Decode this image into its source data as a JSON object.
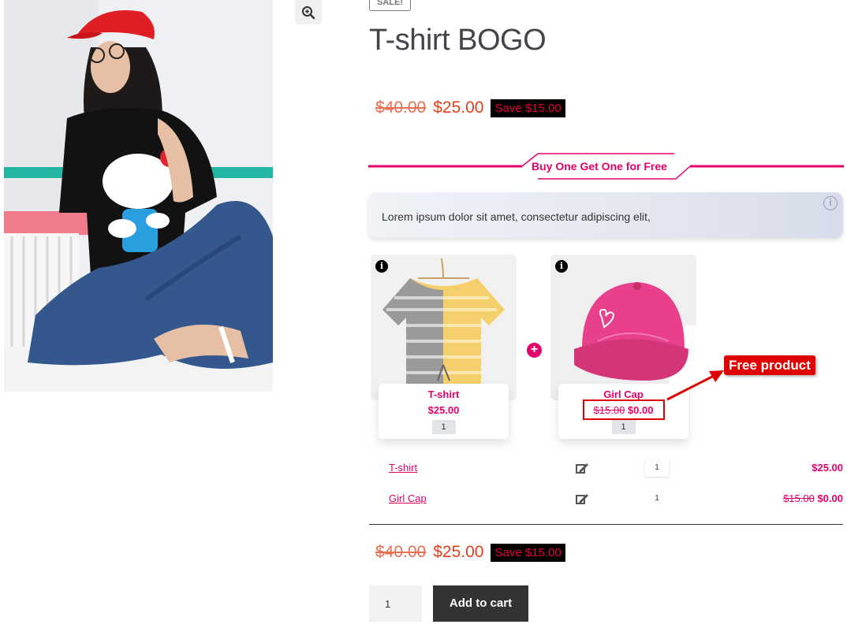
{
  "badge": {
    "sale": "SALE!"
  },
  "product": {
    "title": "T-shirt BOGO",
    "price_old": "$40.00",
    "price_new": "$25.00",
    "save_label": "Save $15.00"
  },
  "bogo": {
    "heading": "Buy One Get One for Free",
    "description": "Lorem ipsum dolor sit amet, consectetur adipiscing elit,",
    "items": [
      {
        "name": "T-shirt",
        "price": "$25.00",
        "qty": "1"
      },
      {
        "name": "Girl Cap",
        "price_old": "$15.00",
        "price_new": "$0.00",
        "qty": "1"
      }
    ],
    "annotation": "Free product"
  },
  "summary": {
    "rows": [
      {
        "name": "T-shirt",
        "qty": "1",
        "price": "$25.00"
      },
      {
        "name": "Girl Cap",
        "qty": "1",
        "price_old": "$15.00",
        "price_new": "$0.00"
      }
    ],
    "total_old": "$40.00",
    "total_new": "$25.00",
    "total_save": "Save $15.00"
  },
  "cart": {
    "qty": "1",
    "button_label": "Add to cart"
  },
  "colors": {
    "accent": "#e4006b",
    "price": "#e2401c",
    "annotation": "#e00000",
    "button": "#333333"
  },
  "icons": [
    "zoom-icon",
    "info-icon",
    "plus-icon",
    "edit-icon",
    "arrow-icon"
  ]
}
